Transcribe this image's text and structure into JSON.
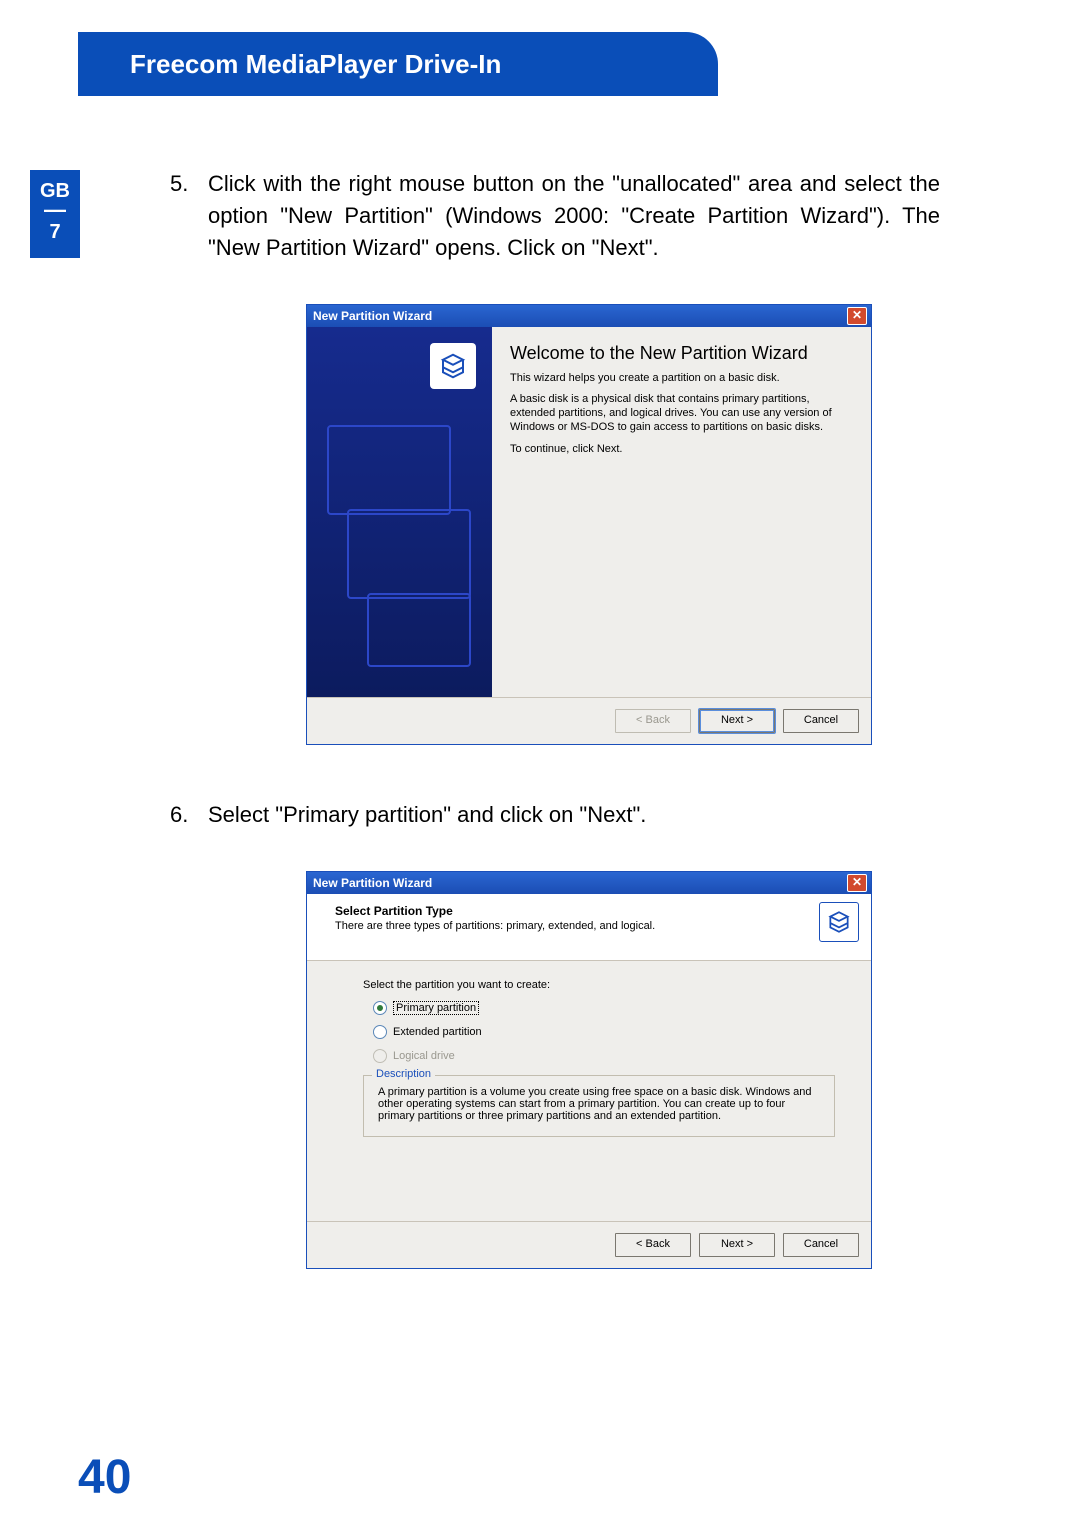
{
  "header": {
    "title": "Freecom MediaPlayer Drive-In"
  },
  "side_tab": {
    "country": "GB",
    "divider": "—",
    "chapter": "7"
  },
  "steps": {
    "s5": {
      "num": "5.",
      "text": "Click with the right mouse button on the \"unallocated\" area and select the option \"New Partition\" (Windows 2000: \"Create Partition Wizard\"). The \"New Partition Wizard\" opens. Click on \"Next\"."
    },
    "s6": {
      "num": "6.",
      "text": "Select \"Primary partition\" and click on \"Next\"."
    }
  },
  "wizard1": {
    "title": "New Partition Wizard",
    "heading": "Welcome to the New Partition Wizard",
    "p1": "This wizard helps you create a partition on a basic disk.",
    "p2": "A basic disk is a physical disk that contains primary partitions, extended partitions, and logical drives. You can use any version of Windows or MS-DOS to gain access to partitions on basic disks.",
    "p3": "To continue, click Next.",
    "back": "< Back",
    "next": "Next >",
    "cancel": "Cancel"
  },
  "wizard2": {
    "title": "New Partition Wizard",
    "head_title": "Select Partition Type",
    "head_sub": "There are three types of partitions: primary, extended, and logical.",
    "prompt": "Select the partition you want to create:",
    "opt_primary": "Primary partition",
    "opt_extended": "Extended partition",
    "opt_logical": "Logical drive",
    "group_legend": "Description",
    "description": "A primary partition is a volume you create using free space on a basic disk. Windows and other operating systems can start from a primary partition. You can create up to four primary partitions or three primary partitions and an extended partition.",
    "back": "< Back",
    "next": "Next >",
    "cancel": "Cancel"
  },
  "page_number": "40"
}
